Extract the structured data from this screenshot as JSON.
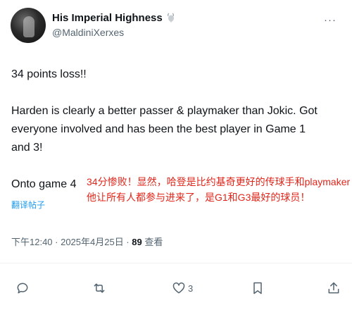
{
  "author": {
    "display_name": "His Imperial Highness",
    "handle": "@MaldiniXerxes"
  },
  "tweet": {
    "p1": "34 points loss!!",
    "p2": "Harden is clearly a better passer & playmaker than Jokic. Got everyone involved and has been the best player in Game 1 and 3!",
    "p3": "Onto game 4"
  },
  "translate_label": "翻译帖子",
  "overlay": {
    "line1": "34分惨败！显然，哈登是比约基奇更好的传球手和playmaker",
    "line2": "他让所有人都参与进来了，是G1和G3最好的球员！"
  },
  "meta": {
    "time_date": "下午12:40 · 2025年4月25日 · ",
    "views_count": "89",
    "views_label": " 查看"
  },
  "actions": {
    "like_count": "3"
  },
  "icons": [
    "goat-icon",
    "more-icon",
    "reply-icon",
    "retweet-icon",
    "like-icon",
    "bookmark-icon",
    "share-icon"
  ],
  "colors": {
    "link": "#1d9bf0",
    "overlay": "#e0261b",
    "muted": "#536471"
  }
}
